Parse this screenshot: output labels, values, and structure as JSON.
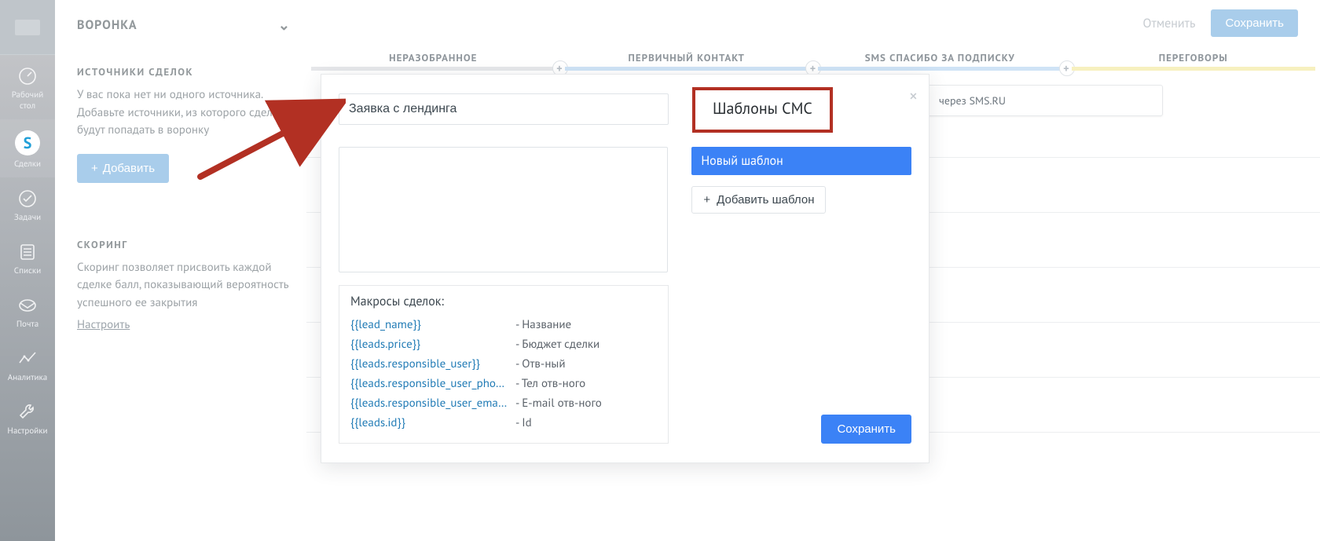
{
  "nav": {
    "items": [
      {
        "id": "desktop",
        "label": "Рабочий\nстол"
      },
      {
        "id": "deals",
        "label": "Сделки"
      },
      {
        "id": "tasks",
        "label": "Задачи"
      },
      {
        "id": "lists",
        "label": "Списки"
      },
      {
        "id": "mail",
        "label": "Почта"
      },
      {
        "id": "analytics",
        "label": "Аналитика"
      },
      {
        "id": "settings",
        "label": "Настройки"
      }
    ]
  },
  "leftpanel": {
    "funnel_title": "ВОРОНКА",
    "sources_title": "ИСТОЧНИКИ СДЕЛОК",
    "sources_text": "У вас пока нет ни одного источника. Добавьте источники, из которого сделки будут попадать в воронку",
    "add_label": "Добавить",
    "scoring_title": "СКОРИНГ",
    "scoring_text": "Скоринг позволяет присвоить каждой сделке балл, показывающий вероятность успешного ее закрытия",
    "scoring_link": "Настроить"
  },
  "topbar": {
    "cancel": "Отменить",
    "save": "Сохранить"
  },
  "stages": [
    {
      "label": "НЕРАЗОБРАННОЕ",
      "color": "gray"
    },
    {
      "label": "ПЕРВИЧНЫЙ КОНТАКТ",
      "color": "blue"
    },
    {
      "label": "SMS СПАСИБО ЗА ПОДПИСКУ",
      "color": "blue"
    },
    {
      "label": "ПЕРЕГОВОРЫ",
      "color": "yellow"
    }
  ],
  "card_behind": {
    "line1_suffix": "через SMS.RU"
  },
  "modal": {
    "name_value": "Заявка с лендинга",
    "templates_header": "Шаблоны СМС",
    "template_selected": "Новый шаблон",
    "add_template": "Добавить шаблон",
    "macros_title": "Макросы сделок:",
    "macros": [
      {
        "key": "{{lead_name}}",
        "desc": "- Название"
      },
      {
        "key": "{{leads.price}}",
        "desc": "- Бюджет сделки"
      },
      {
        "key": "{{leads.responsible_user}}",
        "desc": "- Отв-ный"
      },
      {
        "key": "{{leads.responsible_user_pho…",
        "desc": "- Тел отв-ного"
      },
      {
        "key": "{{leads.responsible_user_ema…",
        "desc": "- E-mail отв-ного"
      },
      {
        "key": "{{leads.id}}",
        "desc": "- Id"
      }
    ],
    "save": "Сохранить"
  }
}
